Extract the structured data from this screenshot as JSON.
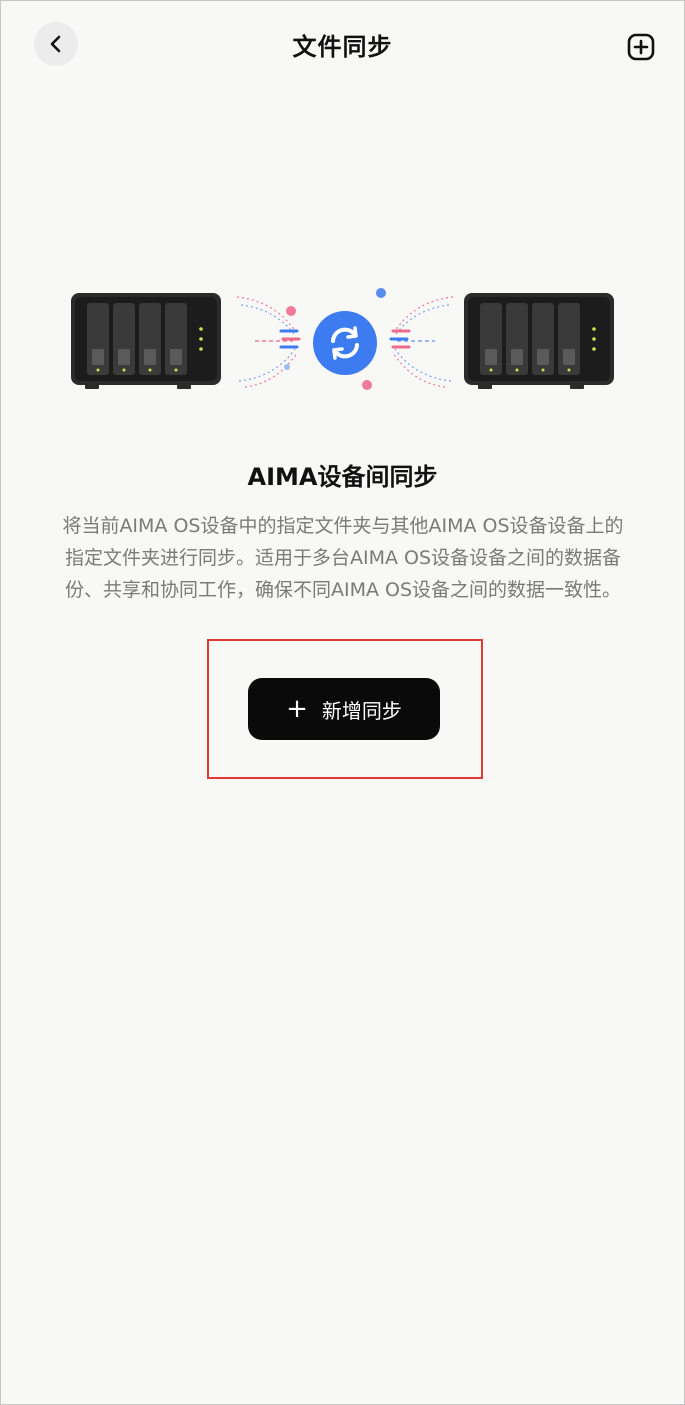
{
  "header": {
    "title": "文件同步",
    "back_icon": "chevron-left-icon",
    "add_icon": "add-square-icon"
  },
  "illustration": {
    "left_device_icon": "nas-device-icon",
    "right_device_icon": "nas-device-icon",
    "sync_icon": "sync-icon",
    "accent_color": "#3d7cf0"
  },
  "content": {
    "title": "AIMA设备间同步",
    "description": "将当前AIMA OS设备中的指定文件夹与其他AIMA OS设备设备上的指定文件夹进行同步。适用于多台AIMA OS设备设备之间的数据备份、共享和协同工作，确保不同AIMA OS设备之间的数据一致性。"
  },
  "action": {
    "plus": "+",
    "label": "新增同步",
    "highlight_color": "#e53935"
  }
}
